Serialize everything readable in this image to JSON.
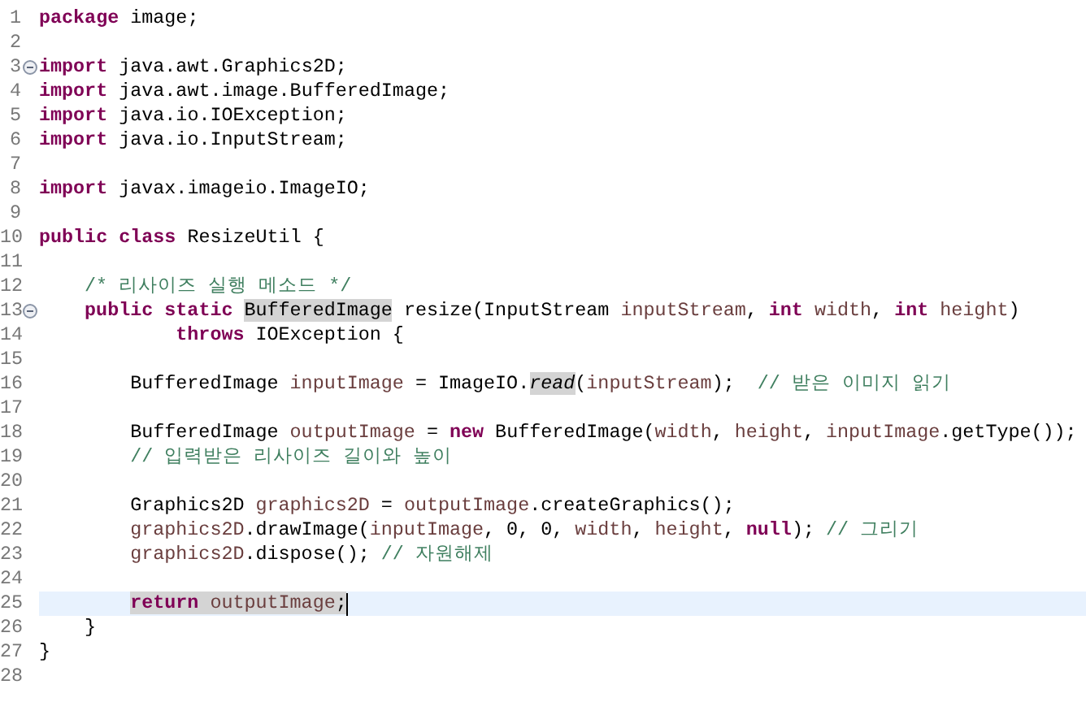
{
  "editor": {
    "lines": [
      {
        "number": "1",
        "fold": false,
        "current": false,
        "tokens": [
          {
            "text": "package",
            "kind": "keyword"
          },
          {
            "text": " image;",
            "kind": "plain"
          }
        ]
      },
      {
        "number": "2",
        "fold": false,
        "current": false
      },
      {
        "number": "3",
        "fold": true,
        "current": false,
        "tokens": [
          {
            "text": "import",
            "kind": "keyword"
          },
          {
            "text": " java.awt.Graphics2D;",
            "kind": "plain"
          }
        ]
      },
      {
        "number": "4",
        "fold": false,
        "current": false,
        "tokens": [
          {
            "text": "import",
            "kind": "keyword"
          },
          {
            "text": " java.awt.image.BufferedImage;",
            "kind": "plain"
          }
        ]
      },
      {
        "number": "5",
        "fold": false,
        "current": false,
        "tokens": [
          {
            "text": "import",
            "kind": "keyword"
          },
          {
            "text": " java.io.IOException;",
            "kind": "plain"
          }
        ]
      },
      {
        "number": "6",
        "fold": false,
        "current": false,
        "tokens": [
          {
            "text": "import",
            "kind": "keyword"
          },
          {
            "text": " java.io.InputStream;",
            "kind": "plain"
          }
        ]
      },
      {
        "number": "7",
        "fold": false,
        "current": false
      },
      {
        "number": "8",
        "fold": false,
        "current": false,
        "tokens": [
          {
            "text": "import",
            "kind": "keyword"
          },
          {
            "text": " javax.imageio.ImageIO;",
            "kind": "plain"
          }
        ]
      },
      {
        "number": "9",
        "fold": false,
        "current": false
      },
      {
        "number": "10",
        "fold": false,
        "current": false,
        "tokens": [
          {
            "text": "public",
            "kind": "keyword"
          },
          {
            "text": " class",
            "kind": "keyword"
          },
          {
            "text": " ResizeUtil {",
            "kind": "plain"
          }
        ]
      },
      {
        "number": "11",
        "fold": false,
        "current": false
      },
      {
        "number": "12",
        "fold": false,
        "current": false,
        "tokens": [
          {
            "text": "    /* 리사이즈 실행 메소드 */",
            "kind": "comment"
          }
        ]
      },
      {
        "number": "13",
        "fold": true,
        "current": false,
        "tokens": [
          {
            "text": "    public",
            "kind": "keyword"
          },
          {
            "text": " static ",
            "kind": "keyword"
          },
          {
            "text": "BufferedImage",
            "kind": "marked"
          },
          {
            "text": " resize(InputStream ",
            "kind": "plain"
          },
          {
            "text": "inputStream",
            "kind": "local"
          },
          {
            "text": ", ",
            "kind": "plain"
          },
          {
            "text": "int ",
            "kind": "keyword"
          },
          {
            "text": "width",
            "kind": "local"
          },
          {
            "text": ", ",
            "kind": "plain"
          },
          {
            "text": "int ",
            "kind": "keyword"
          },
          {
            "text": "height",
            "kind": "local"
          },
          {
            "text": ")",
            "kind": "plain"
          }
        ]
      },
      {
        "number": "14",
        "fold": false,
        "current": false,
        "tokens": [
          {
            "text": "            throws",
            "kind": "keyword"
          },
          {
            "text": " IOException {",
            "kind": "plain"
          }
        ]
      },
      {
        "number": "15",
        "fold": false,
        "current": false
      },
      {
        "number": "16",
        "fold": false,
        "current": false,
        "tokens": [
          {
            "text": "        BufferedImage ",
            "kind": "plain"
          },
          {
            "text": "inputImage",
            "kind": "local"
          },
          {
            "text": " = ImageIO.",
            "kind": "plain"
          },
          {
            "text": "read",
            "kind": "marked-static"
          },
          {
            "text": "(",
            "kind": "plain"
          },
          {
            "text": "inputStream",
            "kind": "local"
          },
          {
            "text": ");  ",
            "kind": "plain"
          },
          {
            "text": "// 받은 이미지 읽기",
            "kind": "comment"
          }
        ]
      },
      {
        "number": "17",
        "fold": false,
        "current": false
      },
      {
        "number": "18",
        "fold": false,
        "current": false,
        "tokens": [
          {
            "text": "        BufferedImage ",
            "kind": "plain"
          },
          {
            "text": "outputImage",
            "kind": "local"
          },
          {
            "text": " = ",
            "kind": "plain"
          },
          {
            "text": "new",
            "kind": "keyword"
          },
          {
            "text": " BufferedImage(",
            "kind": "plain"
          },
          {
            "text": "width",
            "kind": "local"
          },
          {
            "text": ", ",
            "kind": "plain"
          },
          {
            "text": "height",
            "kind": "local"
          },
          {
            "text": ", ",
            "kind": "plain"
          },
          {
            "text": "inputImage",
            "kind": "local"
          },
          {
            "text": ".getType());",
            "kind": "plain"
          }
        ]
      },
      {
        "number": "19",
        "fold": false,
        "current": false,
        "tokens": [
          {
            "text": "        // 입력받은 리사이즈 길이와 높이",
            "kind": "comment"
          }
        ]
      },
      {
        "number": "20",
        "fold": false,
        "current": false
      },
      {
        "number": "21",
        "fold": false,
        "current": false,
        "tokens": [
          {
            "text": "        Graphics2D ",
            "kind": "plain"
          },
          {
            "text": "graphics2D",
            "kind": "local"
          },
          {
            "text": " = ",
            "kind": "plain"
          },
          {
            "text": "outputImage",
            "kind": "local"
          },
          {
            "text": ".createGraphics();",
            "kind": "plain"
          }
        ]
      },
      {
        "number": "22",
        "fold": false,
        "current": false,
        "tokens": [
          {
            "text": "        graphics2D",
            "kind": "local"
          },
          {
            "text": ".drawImage(",
            "kind": "plain"
          },
          {
            "text": "inputImage",
            "kind": "local"
          },
          {
            "text": ", 0, 0, ",
            "kind": "plain"
          },
          {
            "text": "width",
            "kind": "local"
          },
          {
            "text": ", ",
            "kind": "plain"
          },
          {
            "text": "height",
            "kind": "local"
          },
          {
            "text": ", ",
            "kind": "plain"
          },
          {
            "text": "null",
            "kind": "keyword"
          },
          {
            "text": "); ",
            "kind": "plain"
          },
          {
            "text": "// 그리기",
            "kind": "comment"
          }
        ]
      },
      {
        "number": "23",
        "fold": false,
        "current": false,
        "tokens": [
          {
            "text": "        graphics2D",
            "kind": "local"
          },
          {
            "text": ".dispose(); ",
            "kind": "plain"
          },
          {
            "text": "// 자원해제",
            "kind": "comment"
          }
        ]
      },
      {
        "number": "24",
        "fold": false,
        "current": false
      },
      {
        "number": "25",
        "fold": false,
        "current": true,
        "tokens": [
          {
            "text": "        return",
            "kind": "marked-keyword"
          },
          {
            "text": " outputImage",
            "kind": "marked-local"
          },
          {
            "text": ";",
            "kind": "marked"
          }
        ]
      },
      {
        "number": "26",
        "fold": false,
        "current": false,
        "tokens": [
          {
            "text": "    }",
            "kind": "plain"
          }
        ]
      },
      {
        "number": "27",
        "fold": false,
        "current": false,
        "tokens": [
          {
            "text": "}",
            "kind": "plain"
          }
        ]
      },
      {
        "number": "28",
        "fold": false,
        "current": false
      }
    ]
  }
}
